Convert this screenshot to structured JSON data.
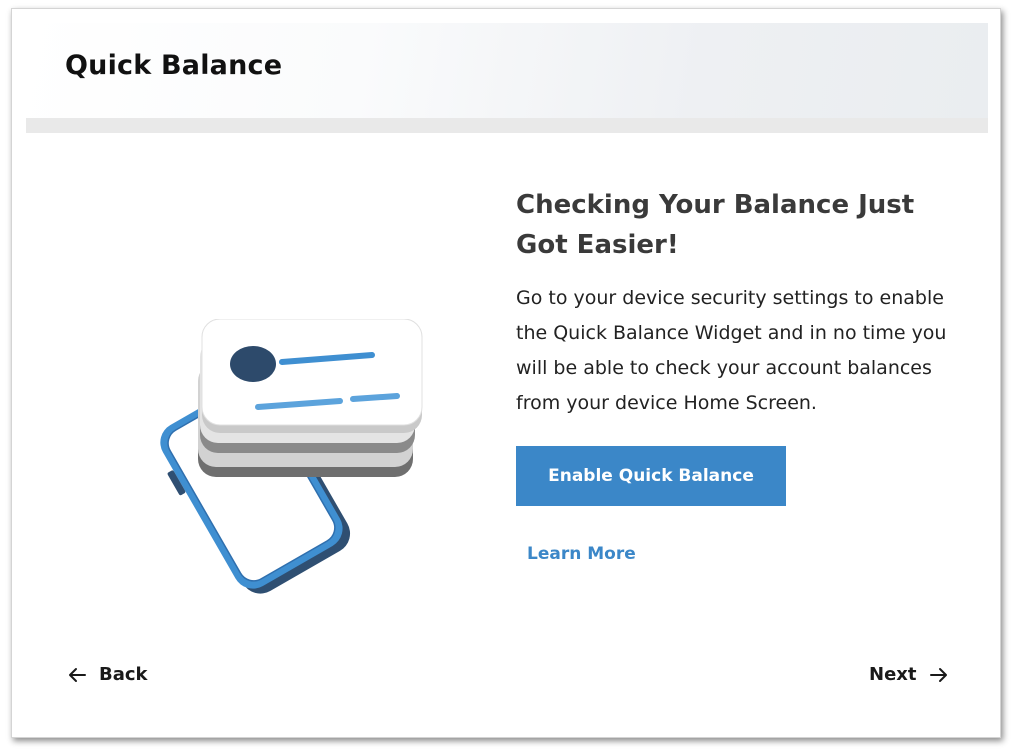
{
  "header": {
    "title": "Quick Balance"
  },
  "content": {
    "headline": "Checking Your Balance Just Got Easier!",
    "body": "Go to your device security settings to enable the Quick Balance Widget and in no time you will be able to check your account balances from your device Home Screen.",
    "primary_button_label": "Enable Quick Balance",
    "secondary_link_label": "Learn More"
  },
  "footer": {
    "back_label": "Back",
    "next_label": "Next"
  },
  "illustration": {
    "icon": "phone-with-balance-cards-icon"
  },
  "colors": {
    "accent": "#3b87c8",
    "title_text": "#111111",
    "headline_text": "#3a3a3a",
    "header_band": "#e9e9e9"
  }
}
